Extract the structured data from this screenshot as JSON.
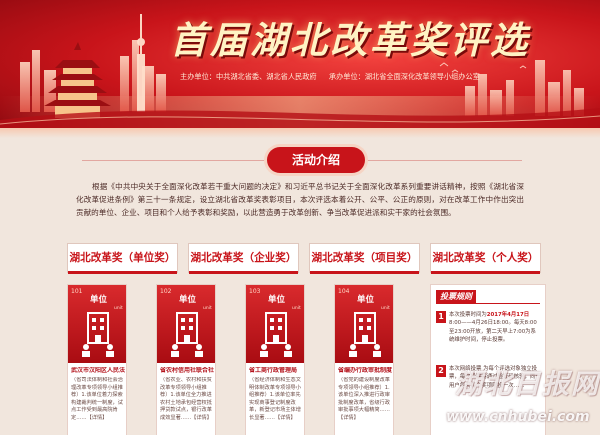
{
  "banner": {
    "title": "首届湖北改革奖评选",
    "organizer": "主办单位：中共湖北省委、湖北省人民政府",
    "undertaker": "承办单位：湖北省全面深化改革领导小组办公室"
  },
  "section": {
    "title": "活动介绍"
  },
  "intro": "根据《中共中央关于全面深化改革若干重大问题的决定》和习近平总书记关于全面深化改革系列重要讲话精神，按照《湖北省深化改革促进条例》第三十一条规定，设立湖北省改革奖表彰项目，本次评选本着公开、公平、公正的原则，对在改革工作中作出突出贡献的单位、企业、项目和个人给予表彰和奖励，以此营造勇于改革创新、争当改革促进派和实干家的社会氛围。",
  "tabs": [
    {
      "label": "湖北改革奖（单位奖）"
    },
    {
      "label": "湖北改革奖（企业奖）"
    },
    {
      "label": "湖北改革奖（项目奖）"
    },
    {
      "label": "湖北改革奖（个人奖）"
    }
  ],
  "cards": [
    {
      "num": "101",
      "unit": "单位",
      "sub": "unit",
      "name": "武汉市汉阳区人民法院",
      "desc": "（省司法体制和社会治理改革专项领导小组推荐）1.该单位着力探索构建裁判统一制度，试点工作受到最高院肯定……【详情】"
    },
    {
      "num": "102",
      "unit": "单位",
      "sub": "unit",
      "name": "省农村信用社联合社",
      "desc": "（省农业、农村和扶贫改革专项领导小组推荐）1.该单位全力推进农村土地承包经营权抵押贷款试点，银行改革成效显著……【详情】"
    },
    {
      "num": "103",
      "unit": "单位",
      "sub": "unit",
      "name": "省工商行政管理局",
      "desc": "（省经济体制和生态文明体制改革专项领导小组推荐）1.该单位率先实现商事登记制度改革，新登记市场主体增长显著……【详情】"
    },
    {
      "num": "104",
      "unit": "单位",
      "sub": "unit",
      "name": "省编办行政审批制度改革处",
      "desc": "（省党的建设制度改革专项领导小组推荐）1.该单位深入推进行政审批制度改革，省级行政审批事项大幅精简……【详情】"
    }
  ],
  "vote": {
    "title": "投票规则",
    "rules": [
      {
        "num": "1",
        "lead": "本次投票时间为",
        "text": "8:00——4月26日18:00。每天8:00至23:00开放，第二天早上7:00为系统维护时间，停止投票。"
      },
      {
        "num": "2",
        "lead": "本次网络投票",
        "text": "为每个评选对象独立投票，每次投票需通过验证码核验，同一用户每天每个奖项限投一次……"
      }
    ],
    "date_highlight": "2017年4月17日"
  },
  "watermark": {
    "logo": "湖北日报网",
    "url": "www.cnhubei.com"
  }
}
